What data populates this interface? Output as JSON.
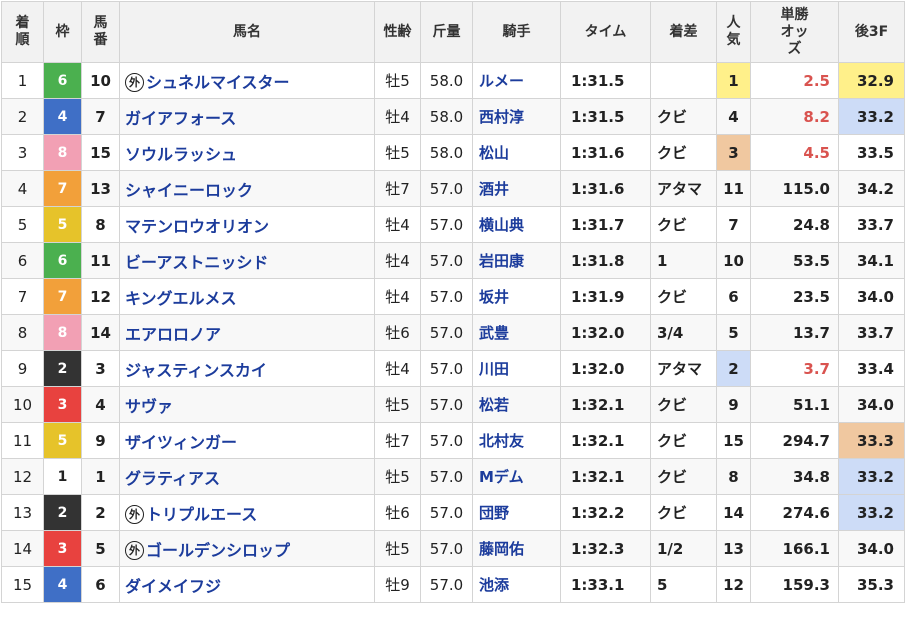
{
  "headers": {
    "rank": "着順",
    "frame": "枠",
    "num": "馬番",
    "name": "馬名",
    "sexage": "性齢",
    "weight": "斤量",
    "jockey": "騎手",
    "time": "タイム",
    "margin": "着差",
    "pop": "人気",
    "odds": "単勝オッズ",
    "last3f": "後3F"
  },
  "foreign_mark": "外",
  "frame_colors": {
    "1": {
      "bg": "#ffffff",
      "fg": "#222222"
    },
    "2": {
      "bg": "#333333",
      "fg": "#ffffff"
    },
    "3": {
      "bg": "#e8423f",
      "fg": "#ffffff"
    },
    "4": {
      "bg": "#3f6fc6",
      "fg": "#ffffff"
    },
    "5": {
      "bg": "#e6c32a",
      "fg": "#ffffff"
    },
    "6": {
      "bg": "#4bb04f",
      "fg": "#ffffff"
    },
    "7": {
      "bg": "#f2a03a",
      "fg": "#ffffff"
    },
    "8": {
      "bg": "#f2a0b4",
      "fg": "#ffffff"
    }
  },
  "highlight_colors": {
    "yellow": "#fff08a",
    "orange": "#f0c8a0",
    "blue": "#cddcf7"
  },
  "odds_red_color": "#d9534f",
  "rows": [
    {
      "rank": "1",
      "frame": "6",
      "num": "10",
      "foreign": true,
      "name": "シュネルマイスター",
      "sexage": "牡5",
      "weight": "58.0",
      "jockey": "ルメー",
      "time": "1:31.5",
      "margin": "",
      "pop": "1",
      "odds": "2.5",
      "odds_red": true,
      "last3f": "32.9",
      "pop_hl": "yellow",
      "f3_hl": "yellow"
    },
    {
      "rank": "2",
      "frame": "4",
      "num": "7",
      "foreign": false,
      "name": "ガイアフォース",
      "sexage": "牡4",
      "weight": "58.0",
      "jockey": "西村淳",
      "time": "1:31.5",
      "margin": "クビ",
      "pop": "4",
      "odds": "8.2",
      "odds_red": true,
      "last3f": "33.2",
      "pop_hl": "",
      "f3_hl": "blue"
    },
    {
      "rank": "3",
      "frame": "8",
      "num": "15",
      "foreign": false,
      "name": "ソウルラッシュ",
      "sexage": "牡5",
      "weight": "58.0",
      "jockey": "松山",
      "time": "1:31.6",
      "margin": "クビ",
      "pop": "3",
      "odds": "4.5",
      "odds_red": true,
      "last3f": "33.5",
      "pop_hl": "orange",
      "f3_hl": ""
    },
    {
      "rank": "4",
      "frame": "7",
      "num": "13",
      "foreign": false,
      "name": "シャイニーロック",
      "sexage": "牡7",
      "weight": "57.0",
      "jockey": "酒井",
      "time": "1:31.6",
      "margin": "アタマ",
      "pop": "11",
      "odds": "115.0",
      "odds_red": false,
      "last3f": "34.2",
      "pop_hl": "",
      "f3_hl": ""
    },
    {
      "rank": "5",
      "frame": "5",
      "num": "8",
      "foreign": false,
      "name": "マテンロウオリオン",
      "sexage": "牡4",
      "weight": "57.0",
      "jockey": "横山典",
      "time": "1:31.7",
      "margin": "クビ",
      "pop": "7",
      "odds": "24.8",
      "odds_red": false,
      "last3f": "33.7",
      "pop_hl": "",
      "f3_hl": ""
    },
    {
      "rank": "6",
      "frame": "6",
      "num": "11",
      "foreign": false,
      "name": "ビーアストニッシド",
      "sexage": "牡4",
      "weight": "57.0",
      "jockey": "岩田康",
      "time": "1:31.8",
      "margin": "1",
      "pop": "10",
      "odds": "53.5",
      "odds_red": false,
      "last3f": "34.1",
      "pop_hl": "",
      "f3_hl": ""
    },
    {
      "rank": "7",
      "frame": "7",
      "num": "12",
      "foreign": false,
      "name": "キングエルメス",
      "sexage": "牡4",
      "weight": "57.0",
      "jockey": "坂井",
      "time": "1:31.9",
      "margin": "クビ",
      "pop": "6",
      "odds": "23.5",
      "odds_red": false,
      "last3f": "34.0",
      "pop_hl": "",
      "f3_hl": ""
    },
    {
      "rank": "8",
      "frame": "8",
      "num": "14",
      "foreign": false,
      "name": "エアロロノア",
      "sexage": "牡6",
      "weight": "57.0",
      "jockey": "武豊",
      "time": "1:32.0",
      "margin": "3/4",
      "pop": "5",
      "odds": "13.7",
      "odds_red": false,
      "last3f": "33.7",
      "pop_hl": "",
      "f3_hl": ""
    },
    {
      "rank": "9",
      "frame": "2",
      "num": "3",
      "foreign": false,
      "name": "ジャスティンスカイ",
      "sexage": "牡4",
      "weight": "57.0",
      "jockey": "川田",
      "time": "1:32.0",
      "margin": "アタマ",
      "pop": "2",
      "odds": "3.7",
      "odds_red": true,
      "last3f": "33.4",
      "pop_hl": "blue",
      "f3_hl": ""
    },
    {
      "rank": "10",
      "frame": "3",
      "num": "4",
      "foreign": false,
      "name": "サヴァ",
      "sexage": "牡5",
      "weight": "57.0",
      "jockey": "松若",
      "time": "1:32.1",
      "margin": "クビ",
      "pop": "9",
      "odds": "51.1",
      "odds_red": false,
      "last3f": "34.0",
      "pop_hl": "",
      "f3_hl": ""
    },
    {
      "rank": "11",
      "frame": "5",
      "num": "9",
      "foreign": false,
      "name": "ザイツィンガー",
      "sexage": "牡7",
      "weight": "57.0",
      "jockey": "北村友",
      "time": "1:32.1",
      "margin": "クビ",
      "pop": "15",
      "odds": "294.7",
      "odds_red": false,
      "last3f": "33.3",
      "pop_hl": "",
      "f3_hl": "orange"
    },
    {
      "rank": "12",
      "frame": "1",
      "num": "1",
      "foreign": false,
      "name": "グラティアス",
      "sexage": "牡5",
      "weight": "57.0",
      "jockey": "Mデム",
      "time": "1:32.1",
      "margin": "クビ",
      "pop": "8",
      "odds": "34.8",
      "odds_red": false,
      "last3f": "33.2",
      "pop_hl": "",
      "f3_hl": "blue"
    },
    {
      "rank": "13",
      "frame": "2",
      "num": "2",
      "foreign": true,
      "name": "トリプルエース",
      "sexage": "牡6",
      "weight": "57.0",
      "jockey": "団野",
      "time": "1:32.2",
      "margin": "クビ",
      "pop": "14",
      "odds": "274.6",
      "odds_red": false,
      "last3f": "33.2",
      "pop_hl": "",
      "f3_hl": "blue"
    },
    {
      "rank": "14",
      "frame": "3",
      "num": "5",
      "foreign": true,
      "name": "ゴールデンシロップ",
      "sexage": "牡5",
      "weight": "57.0",
      "jockey": "藤岡佑",
      "time": "1:32.3",
      "margin": "1/2",
      "pop": "13",
      "odds": "166.1",
      "odds_red": false,
      "last3f": "34.0",
      "pop_hl": "",
      "f3_hl": ""
    },
    {
      "rank": "15",
      "frame": "4",
      "num": "6",
      "foreign": false,
      "name": "ダイメイフジ",
      "sexage": "牡9",
      "weight": "57.0",
      "jockey": "池添",
      "time": "1:33.1",
      "margin": "5",
      "pop": "12",
      "odds": "159.3",
      "odds_red": false,
      "last3f": "35.3",
      "pop_hl": "",
      "f3_hl": ""
    }
  ]
}
